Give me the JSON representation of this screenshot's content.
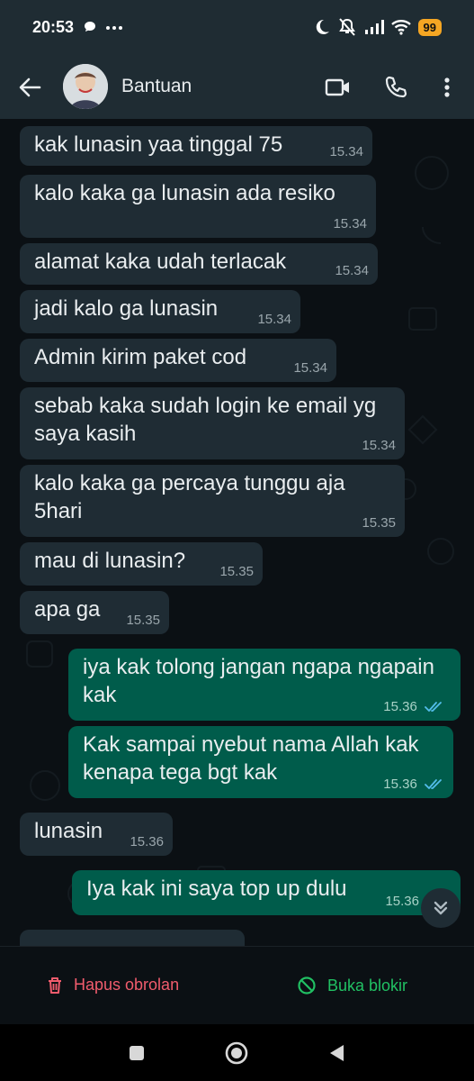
{
  "status_bar": {
    "time": "20:53",
    "battery": "99"
  },
  "header": {
    "contact_name": "Bantuan"
  },
  "messages": [
    {
      "direction": "in",
      "text": "kak lunasin yaa tinggal 75",
      "time": "15.34"
    },
    {
      "direction": "in",
      "text": "kalo kaka ga lunasin ada resiko",
      "time": "15.34"
    },
    {
      "direction": "in",
      "text": "alamat kaka udah terlacak",
      "time": "15.34"
    },
    {
      "direction": "in",
      "text": "jadi kalo ga lunasin",
      "time": "15.34"
    },
    {
      "direction": "in",
      "text": "Admin kirim paket cod",
      "time": "15.34"
    },
    {
      "direction": "in",
      "text": "sebab kaka sudah login ke email yg saya kasih",
      "time": "15.34"
    },
    {
      "direction": "in",
      "text": "kalo kaka ga percaya tunggu aja 5hari",
      "time": "15.35"
    },
    {
      "direction": "in",
      "text": "mau di lunasin?",
      "time": "15.35"
    },
    {
      "direction": "in",
      "text": "apa ga",
      "time": "15.35"
    },
    {
      "direction": "out",
      "text": "iya kak tolong jangan ngapa ngapain kak",
      "time": "15.36"
    },
    {
      "direction": "out",
      "text": "Kak sampai nyebut nama Allah kak kenapa tega bgt kak",
      "time": "15.36"
    },
    {
      "direction": "in",
      "text": "lunasin",
      "time": "15.36"
    },
    {
      "direction": "out",
      "text": "Iya kak ini saya top up dulu",
      "time": "15.36"
    }
  ],
  "actions": {
    "delete_chat": "Hapus obrolan",
    "unblock": "Buka blokir"
  },
  "colors": {
    "incoming_bubble": "#1f2c34",
    "outgoing_bubble": "#005c4b",
    "delete_red": "#f15c6d",
    "unblock_green": "#21c063",
    "read_ticks_blue": "#53bdeb",
    "battery_orange": "#f5a623"
  }
}
